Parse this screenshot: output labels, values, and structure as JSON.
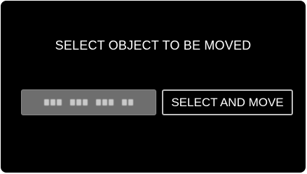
{
  "dialog": {
    "title": "SELECT OBJECT TO BE MOVED"
  },
  "buttons": {
    "select_and_move_label": "SELECT AND MOVE"
  }
}
